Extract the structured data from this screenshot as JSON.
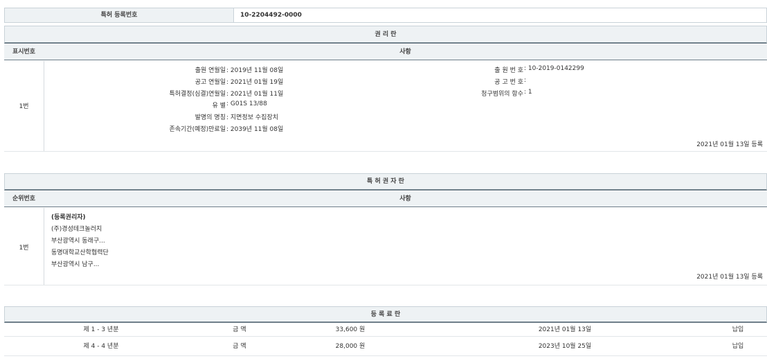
{
  "reg_number_row": {
    "label": "특허 등록번호",
    "value": "10-2204492-0000"
  },
  "rights_section": {
    "title": "권 리 란",
    "col_index": "표시번호",
    "col_detail": "사항",
    "row_index": "1번",
    "left_fields": [
      {
        "label": "출원 연월일",
        "value": "2019년 11월 08일"
      },
      {
        "label": "공고 연월일",
        "value": "2021년 01월 19일"
      },
      {
        "label": "특허결정(심결)연월일",
        "value": "2021년 01월 11일"
      },
      {
        "label": "유 별",
        "value": "G01S 13/88"
      },
      {
        "label": "발명의 명칭",
        "value": "지면정보 수집장치"
      },
      {
        "label": "존속기간(예정)만료일",
        "value": "2039년 11월 08일"
      }
    ],
    "right_fields": [
      {
        "label": "출 원 번 호",
        "value": "10-2019-0142299"
      },
      {
        "label": "공 고 번 호",
        "value": ""
      },
      {
        "label": "청구범위의 항수",
        "value": "1"
      }
    ],
    "reg_date": "2021년 01월 13일 등록"
  },
  "holder_section": {
    "title": "특 허 권 자 란",
    "col_index": "순위번호",
    "col_detail": "사항",
    "row_index": "1번",
    "lines": [
      "(등록권리자)",
      "(주)경성테크놀러지",
      "부산광역시 동래구...",
      "동명대학교산학협력단",
      "부산광역시 남구..."
    ],
    "reg_date": "2021년 01월 13일 등록"
  },
  "fee_section": {
    "title": "등 록 료 란",
    "rows": [
      {
        "period": "제 1 - 3 년분",
        "amount_label": "금 액",
        "amount": "33,600 원",
        "date": "2021년 01월 13일",
        "status": "납입"
      },
      {
        "period": "제 4 - 4 년분",
        "amount_label": "금 액",
        "amount": "28,000 원",
        "date": "2023년 10월 25일",
        "status": "납입"
      }
    ]
  }
}
